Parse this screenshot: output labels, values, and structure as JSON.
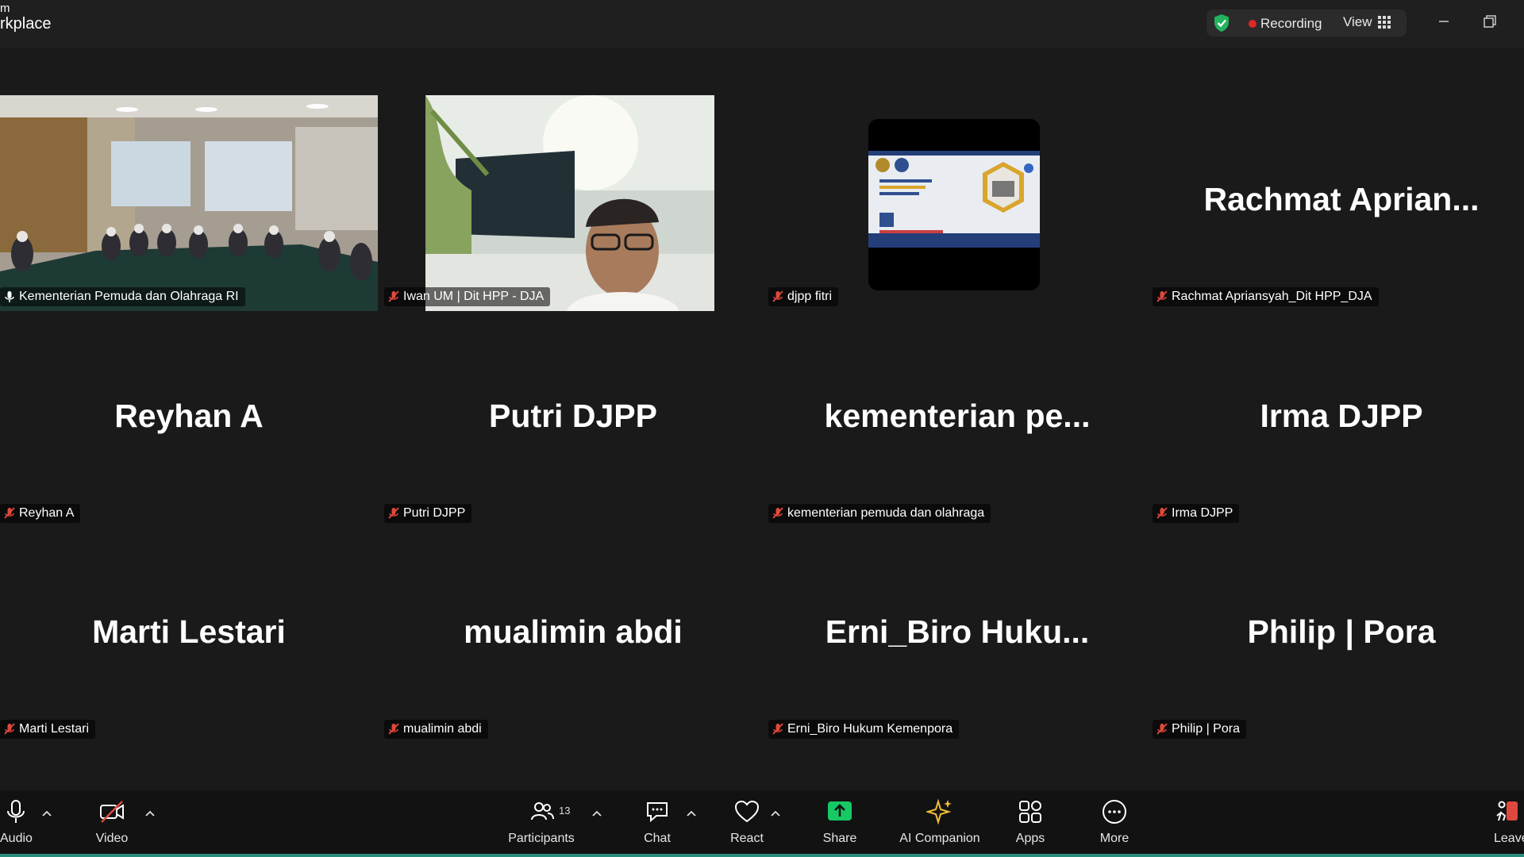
{
  "app": {
    "title_line1": "m",
    "title_line2": "rkplace"
  },
  "status": {
    "recording_label": "Recording",
    "view_label": "View"
  },
  "tiles": [
    {
      "name": "Kementerian Pemuda dan Olahraga RI",
      "big_name": "",
      "muted": false,
      "active": true
    },
    {
      "name": "Iwan UM | Dit HPP - DJA",
      "big_name": "",
      "muted": true,
      "active": false
    },
    {
      "name": "djpp fitri",
      "big_name": "",
      "muted": true,
      "active": false
    },
    {
      "name": "Rachmat Apriansyah_Dit HPP_DJA",
      "big_name": "Rachmat  Aprian...",
      "muted": true,
      "active": false
    },
    {
      "name": "Reyhan A",
      "big_name": "Reyhan A",
      "muted": true,
      "active": false
    },
    {
      "name": "Putri DJPP",
      "big_name": "Putri DJPP",
      "muted": true,
      "active": false
    },
    {
      "name": "kementerian pemuda dan olahraga",
      "big_name": "kementerian  pe...",
      "muted": true,
      "active": false
    },
    {
      "name": "Irma DJPP",
      "big_name": "Irma DJPP",
      "muted": true,
      "active": false
    },
    {
      "name": "Marti Lestari",
      "big_name": "Marti Lestari",
      "muted": true,
      "active": false
    },
    {
      "name": "mualimin abdi",
      "big_name": "mualimin abdi",
      "muted": true,
      "active": false
    },
    {
      "name": "Erni_Biro Hukum Kemenpora",
      "big_name": "Erni_Biro  Huku...",
      "muted": true,
      "active": false
    },
    {
      "name": "Philip | Pora",
      "big_name": "Philip | Pora",
      "muted": true,
      "active": false
    }
  ],
  "toolbar": {
    "audio": "Audio",
    "video": "Video",
    "participants": "Participants",
    "participants_count": "13",
    "chat": "Chat",
    "react": "React",
    "share": "Share",
    "ai_companion": "AI Companion",
    "apps": "Apps",
    "more": "More",
    "leave": "Leave"
  },
  "colors": {
    "active_speaker": "#2de07a",
    "share_green": "#17c964",
    "recording_red": "#e02828",
    "muted_red": "#e0483e"
  }
}
